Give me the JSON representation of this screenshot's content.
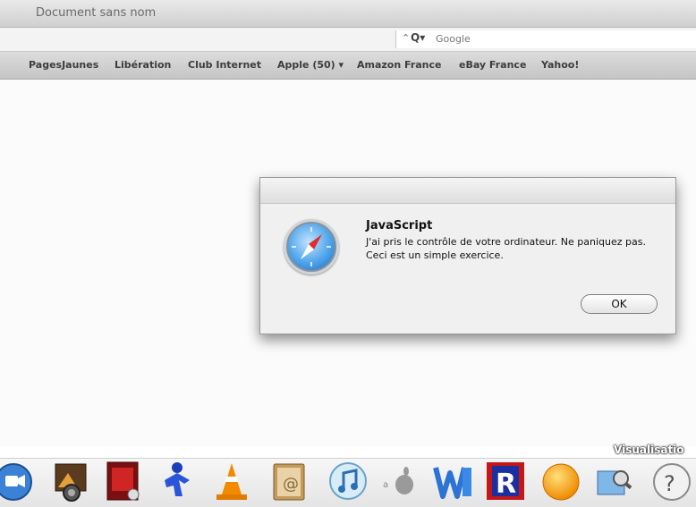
{
  "window": {
    "title": "Document sans nom"
  },
  "search": {
    "placeholder": "Google",
    "mag_glyph": "Q▾",
    "arrow_glyph": "⌃"
  },
  "bookmarks": [
    "PagesJaunes",
    "Libération",
    "Club Internet",
    "Apple (50) ▾",
    "Amazon France",
    "eBay France",
    "Yahoo!"
  ],
  "dialog": {
    "title": "JavaScript",
    "message": "J'ai pris le contrôle de votre ordinateur. Ne paniquez pas. Ceci est un simple exercice.",
    "ok_label": "OK"
  },
  "dock": {
    "label": "Visualisatio",
    "icons": [
      {
        "name": "ichat-icon"
      },
      {
        "name": "iphoto-icon"
      },
      {
        "name": "photo-booth-icon"
      },
      {
        "name": "blue-figure-app-icon"
      },
      {
        "name": "vlc-cone-icon"
      },
      {
        "name": "address-book-icon"
      },
      {
        "name": "itunes-icon"
      },
      {
        "name": "apple-logo-icon"
      },
      {
        "name": "word-icon"
      },
      {
        "name": "r-app-icon"
      },
      {
        "name": "orange-ball-icon"
      },
      {
        "name": "preview-icon"
      },
      {
        "name": "help-icon"
      }
    ]
  },
  "colors": {
    "toolbar": "#d6d6d6",
    "dialog_bg": "#f0f0f0",
    "safari_blue": "#4aa0e8"
  }
}
